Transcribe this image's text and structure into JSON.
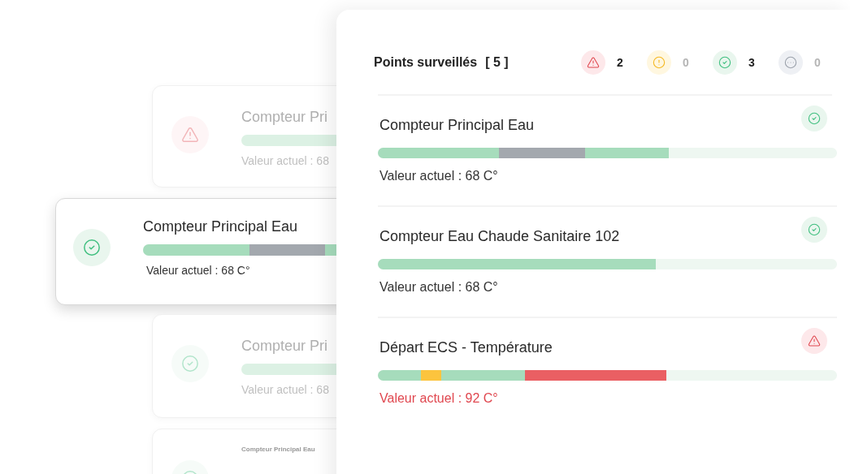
{
  "background_cards": [
    {
      "kind": "alert",
      "compact": false,
      "faded": true,
      "name": "Compteur Pri",
      "segments": [
        {
          "color": "#dcf1e4",
          "level": 1
        }
      ],
      "value": "Valeur actuel : 68"
    },
    {
      "kind": "ok",
      "compact": false,
      "faded": false,
      "name": "Compteur Principal Eau",
      "segments": [
        {
          "color": "#a6dcbc",
          "level": 0.42
        },
        {
          "color": "#a3a8ae"
        },
        {
          "color": "#a6dcbc"
        }
      ],
      "value": "Valeur actuel : 68 C°"
    },
    {
      "kind": "ok",
      "compact": false,
      "faded": true,
      "name": "Compteur Pri",
      "segments": [
        {
          "color": "#dcf1e4",
          "level": 1
        }
      ],
      "value": "Valeur actuel : 68"
    },
    {
      "kind": "ok",
      "compact": true,
      "faded": true,
      "name": "Compteur Principal Eau"
    }
  ],
  "panel": {
    "title": "Points surveillés",
    "count": "[ 5 ]",
    "summary": [
      {
        "kind": "alert",
        "count": "2",
        "muted": false
      },
      {
        "kind": "warning",
        "count": "0",
        "muted": true
      },
      {
        "kind": "ok",
        "count": "3",
        "muted": false
      },
      {
        "kind": "pending",
        "count": "0",
        "muted": true
      }
    ],
    "items": [
      {
        "kind": "ok",
        "name": "Compteur Principal Eau",
        "segments": [
          {
            "color": "#a6dcbc",
            "level": 0.264
          },
          {
            "color": "#a3a8ae"
          },
          {
            "color": "#a6dcbc"
          }
        ],
        "value": "Valeur actuel : 68 C°"
      },
      {
        "kind": "ok",
        "name": "Compteur Eau Chaude Sanitaire 102",
        "segments": [
          {
            "color": "#a6dcbc",
            "level": 0.606
          }
        ],
        "value": "Valeur actuel : 68 C°"
      },
      {
        "kind": "alert",
        "name": "Départ ECS - Température",
        "segments": [
          {
            "color": "#a6dcbc",
            "level": 0.094
          },
          {
            "color": "#fcc43e"
          },
          {
            "color": "#a6dcbc"
          },
          {
            "color": "#ea5f63"
          }
        ],
        "value": "Valeur actuel : 92 C°"
      }
    ]
  }
}
